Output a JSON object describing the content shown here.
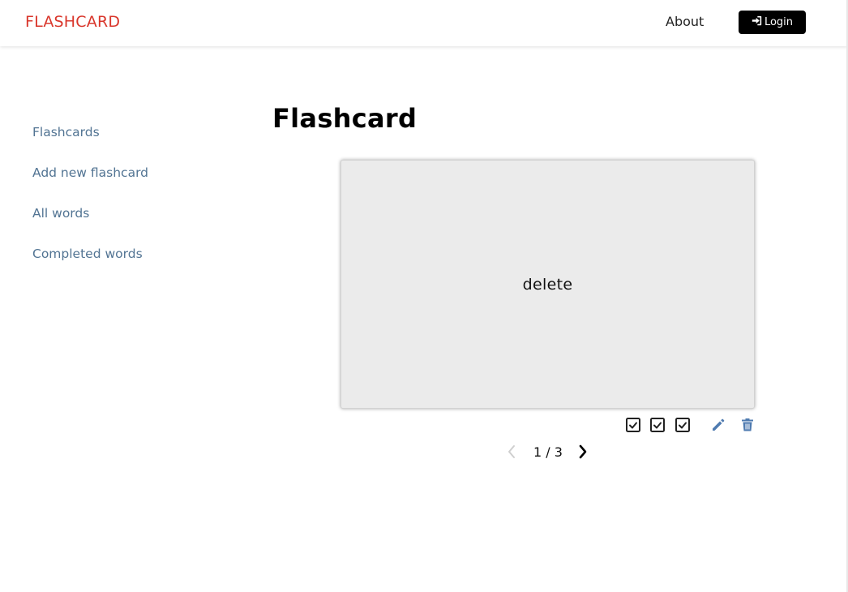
{
  "navbar": {
    "brand": "FLASHCARD",
    "about_label": "About",
    "login_label": "Login",
    "login_icon": "sign-in-icon"
  },
  "sidebar": {
    "items": [
      {
        "label": "Flashcards"
      },
      {
        "label": "Add new flashcard"
      },
      {
        "label": "All words"
      },
      {
        "label": "Completed words"
      }
    ]
  },
  "main": {
    "title": "Flashcard",
    "card": {
      "word": "delete"
    },
    "actions": {
      "check_icons": [
        "check-square-icon",
        "check-square-icon",
        "check-square-icon"
      ],
      "edit_icon": "pencil-icon",
      "delete_icon": "trash-icon"
    },
    "pager": {
      "current": "1",
      "separator": "/",
      "total": "3",
      "prev_icon": "chevron-left-icon",
      "next_icon": "chevron-right-icon"
    }
  },
  "colors": {
    "brand": "#d9362b",
    "sidebar_link": "#527493",
    "action_icon": "#4f7bb0",
    "card_bg": "#ebebeb",
    "login_bg": "#000000"
  }
}
